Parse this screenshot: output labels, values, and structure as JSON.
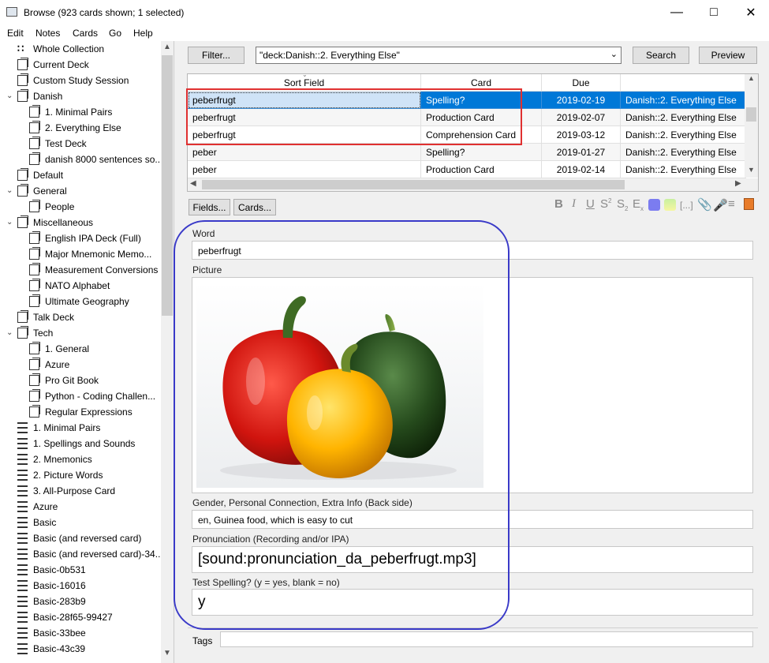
{
  "window": {
    "title": "Browse (923 cards shown; 1 selected)"
  },
  "menu": [
    "Edit",
    "Notes",
    "Cards",
    "Go",
    "Help"
  ],
  "sidebar": {
    "items": [
      {
        "label": "Whole Collection",
        "icon": "collection-icon",
        "level": 0,
        "expander": ""
      },
      {
        "label": "Current Deck",
        "icon": "deck-icon",
        "level": 0,
        "expander": ""
      },
      {
        "label": "Custom Study Session",
        "icon": "deck-icon",
        "level": 0,
        "expander": ""
      },
      {
        "label": "Danish",
        "icon": "deck-icon",
        "level": 0,
        "expander": "⌄"
      },
      {
        "label": "1. Minimal Pairs",
        "icon": "deck-icon",
        "level": 1,
        "expander": ""
      },
      {
        "label": "2. Everything Else",
        "icon": "deck-icon",
        "level": 1,
        "expander": ""
      },
      {
        "label": "Test Deck",
        "icon": "deck-icon",
        "level": 1,
        "expander": ""
      },
      {
        "label": "danish 8000 sentences so...",
        "icon": "deck-icon",
        "level": 1,
        "expander": ""
      },
      {
        "label": "Default",
        "icon": "deck-icon",
        "level": 0,
        "expander": ""
      },
      {
        "label": "General",
        "icon": "deck-icon",
        "level": 0,
        "expander": "⌄"
      },
      {
        "label": "People",
        "icon": "deck-icon",
        "level": 1,
        "expander": ""
      },
      {
        "label": "Miscellaneous",
        "icon": "deck-icon",
        "level": 0,
        "expander": "⌄"
      },
      {
        "label": "English IPA Deck (Full)",
        "icon": "deck-icon",
        "level": 1,
        "expander": ""
      },
      {
        "label": "Major Mnemonic Memo...",
        "icon": "deck-icon",
        "level": 1,
        "expander": ""
      },
      {
        "label": "Measurement Conversions",
        "icon": "deck-icon",
        "level": 1,
        "expander": ""
      },
      {
        "label": "NATO Alphabet",
        "icon": "deck-icon",
        "level": 1,
        "expander": ""
      },
      {
        "label": "Ultimate Geography",
        "icon": "deck-icon",
        "level": 1,
        "expander": ""
      },
      {
        "label": "Talk Deck",
        "icon": "deck-icon",
        "level": 0,
        "expander": ""
      },
      {
        "label": "Tech",
        "icon": "deck-icon",
        "level": 0,
        "expander": "⌄"
      },
      {
        "label": "1. General",
        "icon": "deck-icon",
        "level": 1,
        "expander": ""
      },
      {
        "label": "Azure",
        "icon": "deck-icon",
        "level": 1,
        "expander": ""
      },
      {
        "label": "Pro Git Book",
        "icon": "deck-icon",
        "level": 1,
        "expander": ""
      },
      {
        "label": "Python - Coding Challen...",
        "icon": "deck-icon",
        "level": 1,
        "expander": ""
      },
      {
        "label": "Regular Expressions",
        "icon": "deck-icon",
        "level": 1,
        "expander": ""
      },
      {
        "label": "1. Minimal Pairs",
        "icon": "note-type-icon",
        "level": 0,
        "expander": ""
      },
      {
        "label": "1. Spellings and Sounds",
        "icon": "note-type-icon",
        "level": 0,
        "expander": ""
      },
      {
        "label": "2. Mnemonics",
        "icon": "note-type-icon",
        "level": 0,
        "expander": ""
      },
      {
        "label": "2. Picture Words",
        "icon": "note-type-icon",
        "level": 0,
        "expander": ""
      },
      {
        "label": "3. All-Purpose Card",
        "icon": "note-type-icon",
        "level": 0,
        "expander": ""
      },
      {
        "label": "Azure",
        "icon": "note-type-icon",
        "level": 0,
        "expander": ""
      },
      {
        "label": "Basic",
        "icon": "note-type-icon",
        "level": 0,
        "expander": ""
      },
      {
        "label": "Basic (and reversed card)",
        "icon": "note-type-icon",
        "level": 0,
        "expander": ""
      },
      {
        "label": "Basic (and reversed card)-34...",
        "icon": "note-type-icon",
        "level": 0,
        "expander": ""
      },
      {
        "label": "Basic-0b531",
        "icon": "note-type-icon",
        "level": 0,
        "expander": ""
      },
      {
        "label": "Basic-16016",
        "icon": "note-type-icon",
        "level": 0,
        "expander": ""
      },
      {
        "label": "Basic-283b9",
        "icon": "note-type-icon",
        "level": 0,
        "expander": ""
      },
      {
        "label": "Basic-28f65-99427",
        "icon": "note-type-icon",
        "level": 0,
        "expander": ""
      },
      {
        "label": "Basic-33bee",
        "icon": "note-type-icon",
        "level": 0,
        "expander": ""
      },
      {
        "label": "Basic-43c39",
        "icon": "note-type-icon",
        "level": 0,
        "expander": ""
      }
    ]
  },
  "toolbar": {
    "filter_label": "Filter...",
    "search_value": "\"deck:Danish::2. Everything Else\"",
    "search_label": "Search",
    "preview_label": "Preview"
  },
  "table": {
    "columns": [
      "Sort Field",
      "Card",
      "Due",
      ""
    ],
    "rows": [
      {
        "sort": "peberfrugt",
        "card": "Spelling?",
        "due": "2019-02-19",
        "deck": "Danish::2. Everything Else",
        "selected": true
      },
      {
        "sort": "peberfrugt",
        "card": "Production Card",
        "due": "2019-02-07",
        "deck": "Danish::2. Everything Else",
        "selected": false
      },
      {
        "sort": "peberfrugt",
        "card": "Comprehension Card",
        "due": "2019-03-12",
        "deck": "Danish::2. Everything Else",
        "selected": false
      },
      {
        "sort": "peber",
        "card": "Spelling?",
        "due": "2019-01-27",
        "deck": "Danish::2. Everything Else",
        "selected": false
      },
      {
        "sort": "peber",
        "card": "Production Card",
        "due": "2019-02-14",
        "deck": "Danish::2. Everything Else",
        "selected": false
      }
    ]
  },
  "editor": {
    "fields_button": "Fields...",
    "cards_button": "Cards...",
    "format_icons": [
      "bold-icon",
      "italic-icon",
      "underline-icon",
      "superscript-icon",
      "subscript-icon",
      "clear-format-icon",
      "text-color-icon",
      "highlight-color-icon",
      "cloze-icon",
      "attach-icon",
      "record-audio-icon",
      "more-icon",
      "html-editor-icon"
    ],
    "fields": [
      {
        "label": "Word",
        "value": "peberfrugt"
      },
      {
        "label": "Picture",
        "value": ""
      },
      {
        "label": "Gender, Personal Connection, Extra Info (Back side)",
        "value": "en, Guinea food, which is easy to cut"
      },
      {
        "label": "Pronunciation (Recording and/or IPA)",
        "value": "[sound:pronunciation_da_peberfrugt.mp3]"
      },
      {
        "label": "Test Spelling? (y = yes, blank = no)",
        "value": "y"
      }
    ],
    "tags_label": "Tags",
    "tags_value": ""
  },
  "colors": {
    "selection": "#0078d7",
    "annotation_red": "#e03030",
    "annotation_blue": "#3a3ac8"
  }
}
